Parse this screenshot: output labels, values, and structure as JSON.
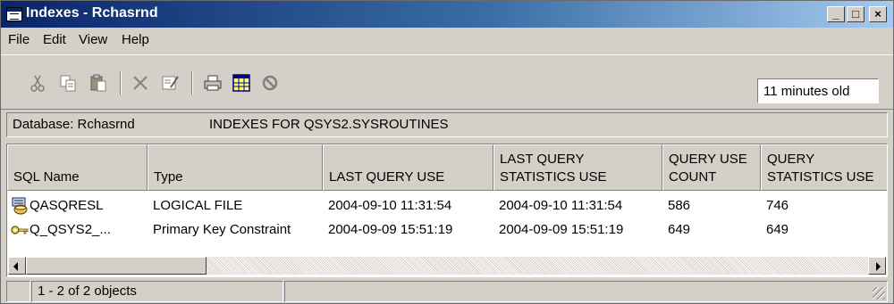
{
  "window": {
    "title": "Indexes - Rchasrnd",
    "controls": {
      "minimize": "_",
      "maximize": "□",
      "close": "×"
    }
  },
  "menu": [
    "File",
    "Edit",
    "View",
    "Help"
  ],
  "toolbar": {
    "icons": [
      "cut-icon",
      "copy-icon",
      "paste-icon",
      "delete-icon",
      "properties-icon",
      "print-icon",
      "table-icon",
      "stop-icon"
    ],
    "age": "11 minutes old"
  },
  "dbbar": {
    "database": "Database: Rchasrnd",
    "title": "INDEXES FOR QSYS2.SYSROUTINES"
  },
  "table": {
    "headers": [
      "SQL Name",
      "Type",
      "LAST QUERY USE",
      "LAST QUERY STATISTICS USE",
      "QUERY USE COUNT",
      "QUERY STATISTICS USE"
    ],
    "rows": [
      {
        "icon": "index-icon",
        "cells": [
          "QASQRESL",
          "LOGICAL FILE",
          "2004-09-10 11:31:54",
          "2004-09-10 11:31:54",
          "586",
          "746"
        ]
      },
      {
        "icon": "key-icon",
        "cells": [
          "Q_QSYS2_...",
          "Primary Key Constraint",
          "2004-09-09 15:51:19",
          "2004-09-09 15:51:19",
          "649",
          "649"
        ]
      }
    ]
  },
  "status": {
    "text": "1 - 2 of 2 objects"
  },
  "colors": {
    "titlebar_start": "#0a246a",
    "titlebar_end": "#a6caf0",
    "face": "#d4d0c8"
  }
}
